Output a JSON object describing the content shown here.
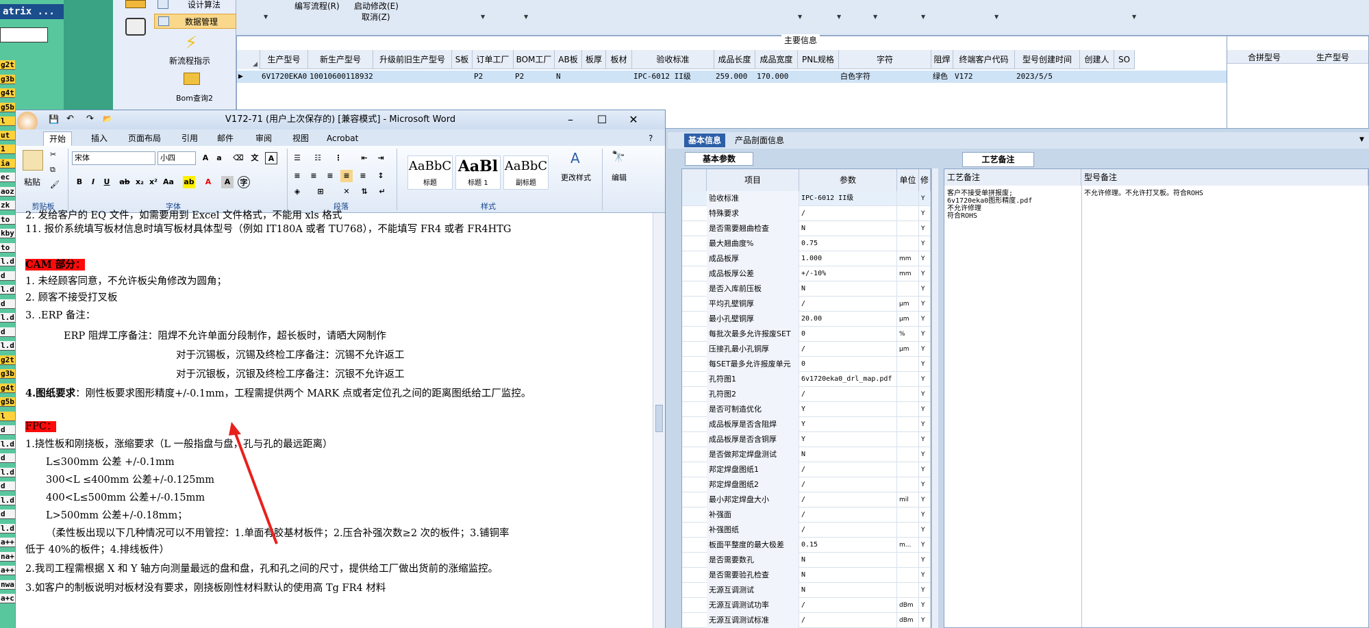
{
  "app": {
    "left_strip": {
      "title": "atrix ...",
      "items": [
        "g2t",
        "g3b",
        "g4t",
        "g5b",
        "l",
        "ut",
        "1",
        "ia",
        "ec",
        "aoz",
        "zk",
        "to",
        "kby",
        "to",
        "l.d",
        "d",
        "l.d",
        "d",
        "l.d",
        "d",
        "l.d",
        "g2t",
        "g3b",
        "g4t",
        "g5b",
        "l",
        "d",
        "l.d",
        "d",
        "l.d",
        "d",
        "l.d",
        "d",
        "l.d",
        "a++",
        "na+",
        "a++",
        "nwa",
        "a+c"
      ]
    },
    "nav": {
      "design_algo": "设计算法",
      "data_manage": "数据管理",
      "new_flow": "新流程指示",
      "bom_query": "Bom查询2"
    },
    "toolbar": {
      "write_flow": "编写流程(R)",
      "start_modify": "启动修改(E)",
      "cancel": "取消(Z)"
    },
    "main_info": {
      "title": "主要信息",
      "columns": [
        "生产型号",
        "新生产型号",
        "升级前旧生产型号",
        "S板",
        "订单工厂",
        "BOM工厂",
        "AB板",
        "板厚",
        "板材",
        "验收标准",
        "成品长度",
        "成品宽度",
        "PNL规格",
        "字符",
        "阻焊",
        "终端客户代码",
        "型号创建时间",
        "创建人",
        "SO"
      ],
      "row": [
        "6V1720EKA0",
        "10010600118932",
        "",
        "",
        "P2",
        "P2",
        "N",
        "",
        "",
        "IPC-6012 II级",
        "259.000",
        "170.000",
        "",
        "白色字符",
        "绿色",
        "V172",
        "2023/5/5",
        "",
        ""
      ],
      "side_columns": [
        "合拼型号",
        "生产型号"
      ]
    }
  },
  "word": {
    "title": "V172-71 (用户上次保存的) [兼容模式] - Microsoft Word",
    "tabs": [
      "开始",
      "插入",
      "页面布局",
      "引用",
      "邮件",
      "审阅",
      "视图",
      "Acrobat"
    ],
    "font_name": "宋体",
    "font_size": "小四",
    "groups": {
      "clipboard": "剪贴板",
      "font": "字体",
      "paragraph": "段落",
      "styles": "样式",
      "edit_label": "编辑"
    },
    "paste": "粘贴",
    "change_styles": "更改样式",
    "styles": [
      {
        "sample": "AaBbC",
        "name": "标题"
      },
      {
        "sample": "AaBl",
        "name": "标题 1"
      },
      {
        "sample": "AaBbC",
        "name": "副标题"
      }
    ],
    "doc": {
      "line_cut": "2. 发给客户的 EQ 文件，如需要用到 Excel 文件格式，不能用 xls 格式",
      "line11": "11. 报价系统填写板材信息时填写板材具体型号（例如 IT180A  或者 TU768），不能填写 FR4 或者 FR4HTG",
      "cam_heading": "CAM 部分：",
      "cam1": "1.    未经顾客同意，不允许板尖角修改为圆角；",
      "cam2": "2.    顾客不接受打叉板",
      "cam3": "3.    .ERP 备注：",
      "erp1": "ERP 阻焊工序备注：阻焊不允许单面分段制作，超长板时，请晒大网制作",
      "erp2": "对于沉锡板，沉锡及终检工序备注：沉锡不允许返工",
      "erp3": "对于沉银板，沉银及终检工序备注：沉银不允许返工",
      "drawing_label": "4.图纸要求",
      "drawing_text": "：刚性板要求图形精度+/-0.1mm，工程需提供两个 MARK 点或者定位孔之间的距离图纸给工厂监控。",
      "fpc_heading": "FPC：",
      "fpc1": "1.挠性板和刚挠板，涨缩要求（L 一般指盘与盘，孔与孔的最远距离）",
      "tol1": "L≤300mm  公差  +/-0.1mm",
      "tol2": "300<L  ≤400mm  公差+/-0.125mm",
      "tol3": "400<L≤500mm  公差+/-0.15mm",
      "tol4": "L>500mm  公差+/-0.18mm；",
      "flex_note": "（柔性板出现以下几种情况可以不用管控：1.单面有胶基材板件；2.压合补强次数≥2 次的板件；3.铺铜率",
      "flex_note2": "低于 40%的板件；4.排线板件）",
      "fpc2": "2.我司工程需根据 X 和 Y 轴方向测量最远的盘和盘，孔和孔之间的尺寸，提供给工厂做出货前的涨缩监控。",
      "fpc3": "3.如客户的制板说明对板材没有要求，刚挠板刚性材料默认的使用高 Tg FR4 材料"
    }
  },
  "right_panel": {
    "tabs": [
      "基本信息",
      "产品剖面信息"
    ],
    "basic_params_title": "基本参数",
    "param_headers": [
      "项目",
      "参数",
      "单位",
      "修"
    ],
    "params": [
      {
        "item": "验收标准",
        "value": "IPC-6012 II级",
        "unit": "",
        "y": "Y"
      },
      {
        "item": "特殊要求",
        "value": "/",
        "unit": "",
        "y": "Y"
      },
      {
        "item": "是否需要翘曲检查",
        "value": "N",
        "unit": "",
        "y": "Y"
      },
      {
        "item": "最大翘曲度%",
        "value": "0.75",
        "unit": "",
        "y": "Y"
      },
      {
        "item": "成品板厚",
        "value": "1.000",
        "unit": "mm",
        "y": "Y"
      },
      {
        "item": "成品板厚公差",
        "value": "+/-10%",
        "unit": "mm",
        "y": "Y"
      },
      {
        "item": "是否入库前压板",
        "value": "N",
        "unit": "",
        "y": "Y"
      },
      {
        "item": "平均孔壁铜厚",
        "value": "/",
        "unit": "μm",
        "y": "Y"
      },
      {
        "item": "最小孔壁铜厚",
        "value": "20.00",
        "unit": "μm",
        "y": "Y"
      },
      {
        "item": "每批次最多允许报废SET",
        "value": "0",
        "unit": "%",
        "y": "Y"
      },
      {
        "item": "压接孔最小孔铜厚",
        "value": "/",
        "unit": "μm",
        "y": "Y"
      },
      {
        "item": "每SET最多允许报废单元",
        "value": "0",
        "unit": "",
        "y": "Y"
      },
      {
        "item": "孔符图1",
        "value": "6v1720eka0_drl_map.pdf",
        "unit": "",
        "y": "Y"
      },
      {
        "item": "孔符图2",
        "value": "/",
        "unit": "",
        "y": "Y"
      },
      {
        "item": "是否可制造优化",
        "value": "Y",
        "unit": "",
        "y": "Y"
      },
      {
        "item": "成品板厚是否含阻焊",
        "value": "Y",
        "unit": "",
        "y": "Y"
      },
      {
        "item": "成品板厚是否含铜厚",
        "value": "Y",
        "unit": "",
        "y": "Y"
      },
      {
        "item": "是否做邦定焊盘测试",
        "value": "N",
        "unit": "",
        "y": "Y"
      },
      {
        "item": "邦定焊盘图纸1",
        "value": "/",
        "unit": "",
        "y": "Y"
      },
      {
        "item": "邦定焊盘图纸2",
        "value": "/",
        "unit": "",
        "y": "Y"
      },
      {
        "item": "最小邦定焊盘大小",
        "value": "/",
        "unit": "mil",
        "y": "Y"
      },
      {
        "item": "补强面",
        "value": "/",
        "unit": "",
        "y": "Y"
      },
      {
        "item": "补强图纸",
        "value": "/",
        "unit": "",
        "y": "Y"
      },
      {
        "item": "板面平整度的最大极差",
        "value": "0.15",
        "unit": "m...",
        "y": "Y"
      },
      {
        "item": "是否需要数孔",
        "value": "N",
        "unit": "",
        "y": "Y"
      },
      {
        "item": "是否需要验孔检查",
        "value": "N",
        "unit": "",
        "y": "Y"
      },
      {
        "item": "无源互调测试",
        "value": "N",
        "unit": "",
        "y": "Y"
      },
      {
        "item": "无源互调测试功率",
        "value": "/",
        "unit": "dBm",
        "y": "Y"
      },
      {
        "item": "无源互调测试标准",
        "value": "/",
        "unit": "dBm",
        "y": "Y"
      }
    ],
    "craft_title": "工艺备注",
    "craft_headers": [
      "工艺备注",
      "型号备注"
    ],
    "craft_note": [
      "客户不接受单拼报废;",
      "6v1720eka0图形精度.pdf",
      "不允许修理",
      "符合ROHS"
    ],
    "model_note": "不允许修理。不允许打叉板。符合ROHS"
  }
}
